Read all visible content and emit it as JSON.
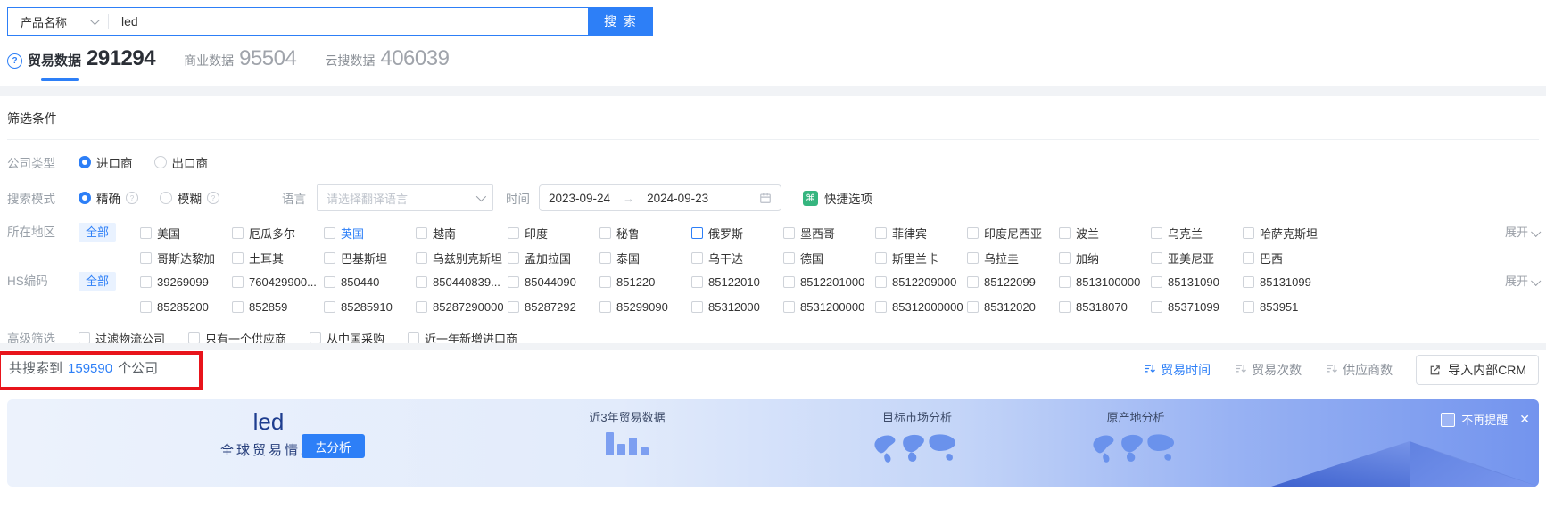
{
  "search": {
    "category": "产品名称",
    "query": "led",
    "button": "搜 索"
  },
  "tabs": [
    {
      "label": "贸易数据",
      "count": "291294",
      "active": true
    },
    {
      "label": "商业数据",
      "count": "95504",
      "active": false
    },
    {
      "label": "云搜数据",
      "count": "406039",
      "active": false
    }
  ],
  "filter": {
    "title": "筛选条件",
    "rows": {
      "company_type": {
        "label": "公司类型",
        "options": [
          {
            "label": "进口商",
            "selected": true
          },
          {
            "label": "出口商",
            "selected": false
          }
        ]
      },
      "search_mode": {
        "label": "搜索模式",
        "options": [
          {
            "label": "精确",
            "selected": true
          },
          {
            "label": "模糊",
            "selected": false
          }
        ],
        "language_label": "语言",
        "language_placeholder": "请选择翻译语言",
        "time_label": "时间",
        "date_start": "2023-09-24",
        "date_end": "2024-09-23",
        "quick_label": "快捷选项"
      },
      "region": {
        "label": "所在地区",
        "all": "全部",
        "expand": "展开",
        "items": [
          {
            "label": "美国"
          },
          {
            "label": "厄瓜多尔"
          },
          {
            "label": "英国",
            "text_blue": true
          },
          {
            "label": "越南"
          },
          {
            "label": "印度"
          },
          {
            "label": "秘鲁"
          },
          {
            "label": "俄罗斯",
            "box_blue": true
          },
          {
            "label": "墨西哥"
          },
          {
            "label": "菲律宾"
          },
          {
            "label": "印度尼西亚"
          },
          {
            "label": "波兰"
          },
          {
            "label": "乌克兰"
          },
          {
            "label": "哈萨克斯坦"
          },
          {
            "label": "哥斯达黎加"
          },
          {
            "label": "土耳其"
          },
          {
            "label": "巴基斯坦"
          },
          {
            "label": "乌兹别克斯坦"
          },
          {
            "label": "孟加拉国"
          },
          {
            "label": "泰国"
          },
          {
            "label": "乌干达"
          },
          {
            "label": "德国"
          },
          {
            "label": "斯里兰卡"
          },
          {
            "label": "乌拉圭"
          },
          {
            "label": "加纳"
          },
          {
            "label": "亚美尼亚"
          },
          {
            "label": "巴西"
          }
        ]
      },
      "hs_code": {
        "label": "HS编码",
        "all": "全部",
        "expand": "展开",
        "items": [
          {
            "label": "39269099"
          },
          {
            "label": "760429900..."
          },
          {
            "label": "850440"
          },
          {
            "label": "850440839..."
          },
          {
            "label": "85044090"
          },
          {
            "label": "851220"
          },
          {
            "label": "85122010"
          },
          {
            "label": "8512201000"
          },
          {
            "label": "8512209000"
          },
          {
            "label": "85122099"
          },
          {
            "label": "8513100000"
          },
          {
            "label": "85131090"
          },
          {
            "label": "85131099"
          },
          {
            "label": "85285200"
          },
          {
            "label": "852859"
          },
          {
            "label": "85285910"
          },
          {
            "label": "85287290000"
          },
          {
            "label": "85287292"
          },
          {
            "label": "85299090"
          },
          {
            "label": "85312000"
          },
          {
            "label": "8531200000"
          },
          {
            "label": "85312000000"
          },
          {
            "label": "85312020"
          },
          {
            "label": "85318070"
          },
          {
            "label": "85371099"
          },
          {
            "label": "853951"
          }
        ]
      },
      "advanced": {
        "label": "高级筛选",
        "items": [
          {
            "label": "过滤物流公司"
          },
          {
            "label": "只有一个供应商"
          },
          {
            "label": "从中国采购"
          },
          {
            "label": "近一年新增进口商"
          }
        ]
      }
    }
  },
  "results": {
    "prefix": "共搜索到",
    "count": "159590",
    "suffix": "个公司",
    "sorts": [
      {
        "label": "贸易时间",
        "active": true
      },
      {
        "label": "贸易次数",
        "active": false
      },
      {
        "label": "供应商数",
        "active": false
      }
    ],
    "crm_button": "导入内部CRM"
  },
  "banner": {
    "keyword": "led",
    "subtitle": "全球贸易情况",
    "analyze_button": "去分析",
    "sections": [
      {
        "label": "近3年贸易数据"
      },
      {
        "label": "目标市场分析"
      },
      {
        "label": "原产地分析"
      }
    ],
    "chart_bars": [
      26,
      13,
      20,
      9
    ],
    "dismiss_label": "不再提醒",
    "close": "✕"
  },
  "colors": {
    "primary": "#2d7ff7",
    "annotation_red": "#e8141b",
    "quick_icon_green": "#35b57f",
    "banner_navy": "#1e3d8f"
  }
}
